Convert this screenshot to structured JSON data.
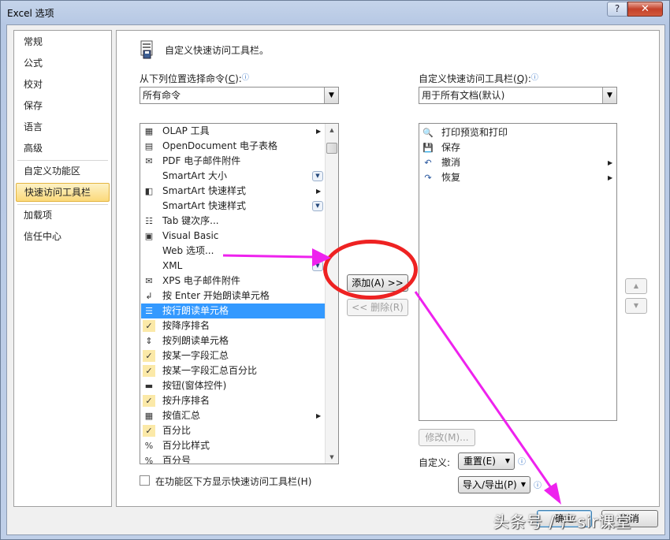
{
  "window": {
    "title": "Excel 选项",
    "help_label": "?",
    "close_label": "✕"
  },
  "nav": {
    "items": [
      {
        "label": "常规"
      },
      {
        "label": "公式"
      },
      {
        "label": "校对"
      },
      {
        "label": "保存"
      },
      {
        "label": "语言"
      },
      {
        "label": "高级"
      },
      {
        "label": "自定义功能区"
      },
      {
        "label": "快速访问工具栏",
        "active": true
      },
      {
        "label": "加载项"
      },
      {
        "label": "信任中心"
      }
    ]
  },
  "header": {
    "title": "自定义快速访问工具栏。"
  },
  "left": {
    "label": "从下列位置选择命令(",
    "label_key": "C",
    "label_end": "):",
    "combo_value": "所有命令",
    "items": [
      {
        "label": "OLAP 工具",
        "icon": "olap-icon",
        "glyph": "▦",
        "submenu": true
      },
      {
        "label": "OpenDocument 电子表格",
        "icon": "opendocument-icon",
        "glyph": "▤"
      },
      {
        "label": "PDF 电子邮件附件",
        "icon": "pdf-mail-icon",
        "glyph": "✉"
      },
      {
        "label": "SmartArt 大小",
        "icon": "none",
        "glyph": "",
        "dropdown": true
      },
      {
        "label": "SmartArt 快速样式",
        "icon": "smartart-style-icon",
        "glyph": "◧",
        "submenu": true
      },
      {
        "label": "SmartArt 快速样式",
        "icon": "none",
        "glyph": "",
        "dropdown": true
      },
      {
        "label": "Tab 键次序...",
        "icon": "tab-order-icon",
        "glyph": "☷"
      },
      {
        "label": "Visual Basic",
        "icon": "visual-basic-icon",
        "glyph": "▣"
      },
      {
        "label": "Web 选项...",
        "icon": "none",
        "glyph": ""
      },
      {
        "label": "XML",
        "icon": "none",
        "glyph": "",
        "dropdown": true
      },
      {
        "label": "XPS 电子邮件附件",
        "icon": "xps-mail-icon",
        "glyph": "✉"
      },
      {
        "label": "按 Enter 开始朗读单元格",
        "icon": "enter-read-icon",
        "glyph": "↲"
      },
      {
        "label": "按行朗读单元格",
        "icon": "read-rows-icon",
        "glyph": "☰",
        "selected": true
      },
      {
        "label": "按降序排名",
        "icon": "check-icon",
        "glyph": "✓"
      },
      {
        "label": "按列朗读单元格",
        "icon": "read-columns-icon",
        "glyph": "⇕"
      },
      {
        "label": "按某一字段汇总",
        "icon": "check-icon",
        "glyph": "✓"
      },
      {
        "label": "按某一字段汇总百分比",
        "icon": "check-icon",
        "glyph": "✓"
      },
      {
        "label": "按钮(窗体控件)",
        "icon": "form-button-icon",
        "glyph": "▬"
      },
      {
        "label": "按升序排名",
        "icon": "check-icon",
        "glyph": "✓"
      },
      {
        "label": "按值汇总",
        "icon": "sum-values-icon",
        "glyph": "▦",
        "submenu": true
      },
      {
        "label": "百分比",
        "icon": "check-icon",
        "glyph": "✓"
      },
      {
        "label": "百分比样式",
        "icon": "percent-icon",
        "glyph": "%"
      },
      {
        "label": "百分号",
        "icon": "percent-sign-icon",
        "glyph": "%"
      }
    ]
  },
  "right": {
    "label": "自定义快速访问工具栏(",
    "label_key": "Q",
    "label_end": "):",
    "combo_value": "用于所有文档(默认)",
    "items": [
      {
        "label": "打印预览和打印",
        "icon": "print-preview-icon",
        "glyph": "🔍"
      },
      {
        "label": "保存",
        "icon": "save-icon",
        "glyph": "💾"
      },
      {
        "label": "撤消",
        "icon": "undo-icon",
        "glyph": "↶",
        "submenu": true
      },
      {
        "label": "恢复",
        "icon": "redo-icon",
        "glyph": "↷",
        "submenu": true
      }
    ]
  },
  "buttons": {
    "add": "添加(A) >>",
    "remove": "<< 删除(R)",
    "modify": "修改(M)...",
    "reset": "重置(E)",
    "import_export": "导入/导出(P)",
    "ok": "确定",
    "cancel": "取消",
    "up": "▲",
    "down": "▼"
  },
  "customize_label": "自定义:",
  "show_below_ribbon": "在功能区下方显示快速访问工具栏(H)",
  "watermark": "头条号 / 严sir课堂",
  "colors": {
    "selection": "#3399ff",
    "active_nav": "#fbd97a",
    "annotation_red": "#ee2222",
    "annotation_magenta": "#ee22ee"
  }
}
